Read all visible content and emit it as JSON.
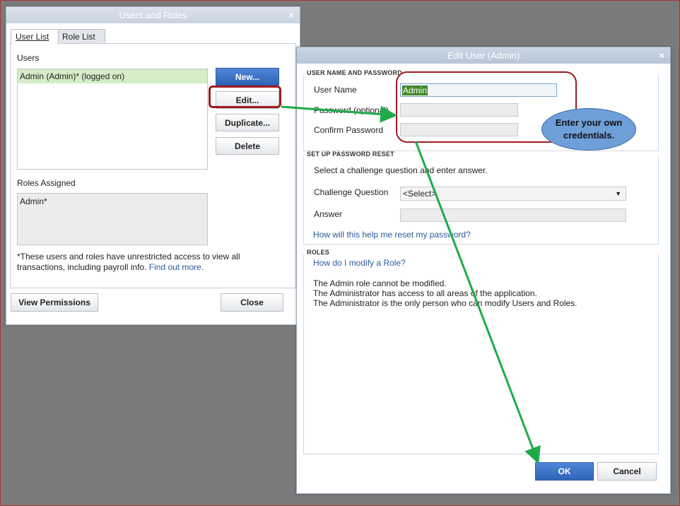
{
  "users_roles": {
    "title": "Users and Roles",
    "close_x": "×",
    "tabs": [
      {
        "label": "User List"
      },
      {
        "label": "Role List"
      }
    ],
    "users_label": "Users",
    "users_list": [
      {
        "name": "Admin (Admin)* (logged on)"
      }
    ],
    "buttons": {
      "new": "New...",
      "edit": "Edit...",
      "duplicate": "Duplicate...",
      "delete": "Delete"
    },
    "roles_label": "Roles Assigned",
    "roles_list": [
      {
        "name": "Admin*"
      }
    ],
    "note": "*These users and roles have unrestricted access to view all transactions, including payroll info.",
    "find_out_more": "Find out more.",
    "view_permissions": "View Permissions",
    "close": "Close"
  },
  "edit_user": {
    "title": "Edit User (Admin)",
    "close_x": "×",
    "section_user": "USER NAME AND PASSWORD",
    "user_name_label": "User Name",
    "user_name_value": "Admin",
    "password_label": "Password (optional)",
    "confirm_label": "Confirm Password",
    "section_reset": "SET UP PASSWORD RESET",
    "reset_instructions": "Select a challenge question and enter answer.",
    "challenge_label": "Challenge Question",
    "challenge_value": "<Select>",
    "answer_label": "Answer",
    "help_link": "How will this help me reset my password?",
    "section_roles": "ROLES",
    "roles_link": "How do I modify a Role?",
    "roles_lines": [
      "The Admin role cannot be modified.",
      "The Administrator has access to all areas of the application.",
      "The Administrator is the only person who can modify Users and Roles."
    ],
    "ok": "OK",
    "cancel": "Cancel"
  },
  "annotation": {
    "callout": "Enter your own credentials."
  },
  "colors": {
    "highlight": "#a01c20",
    "arrow": "#1faa4a",
    "callout_fill": "#6f9fd8",
    "primary_button": "#3b6fc2"
  }
}
